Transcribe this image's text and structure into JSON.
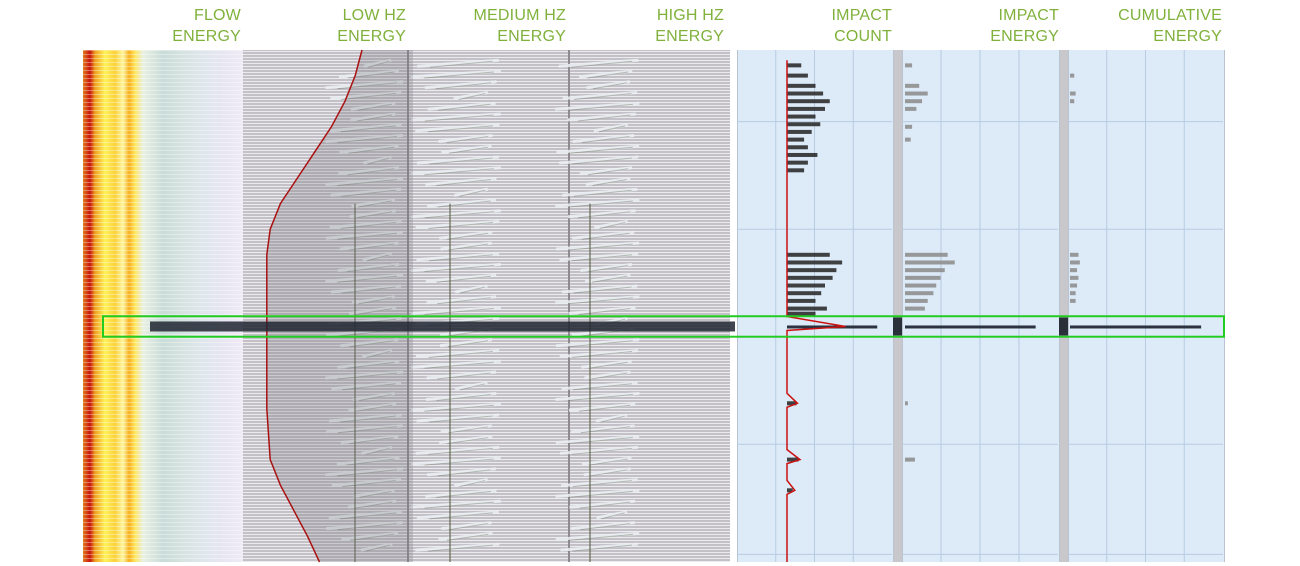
{
  "headers": {
    "flow": [
      "FLOW",
      "ENERGY"
    ],
    "low_hz": [
      "LOW HZ",
      "ENERGY"
    ],
    "medium_hz": [
      "MEDIUM HZ",
      "ENERGY"
    ],
    "high_hz": [
      "HIGH HZ",
      "ENERGY"
    ],
    "impact_count": [
      "IMPACT",
      "COUNT"
    ],
    "impact_energy": [
      "IMPACT",
      "ENERGY"
    ],
    "cumulative_energy": [
      "CUMULATIVE",
      "ENERGY"
    ]
  },
  "colors": {
    "header_text": "#7fb13b",
    "highlight_box": "#22cc22",
    "count_curve": "#cc1111",
    "flow_curve": "#aa1111",
    "bar_panel_bg": "#ddeaf8",
    "dark_band": "#1e2430"
  },
  "chart_data": {
    "type": "bar",
    "orientation": "horizontal",
    "x_axis": "track depth, top to bottom (unlabeled, 0–1)",
    "highlight": {
      "from": 0.52,
      "to": 0.56
    },
    "dark_band_position": 0.54,
    "impact_count": {
      "bars": [
        [
          0.03,
          0.15
        ],
        [
          0.05,
          0.22
        ],
        [
          0.07,
          0.3
        ],
        [
          0.085,
          0.38
        ],
        [
          0.1,
          0.45
        ],
        [
          0.115,
          0.4
        ],
        [
          0.13,
          0.3
        ],
        [
          0.145,
          0.35
        ],
        [
          0.16,
          0.26
        ],
        [
          0.175,
          0.18
        ],
        [
          0.19,
          0.22
        ],
        [
          0.205,
          0.32
        ],
        [
          0.22,
          0.22
        ],
        [
          0.235,
          0.18
        ],
        [
          0.4,
          0.45
        ],
        [
          0.415,
          0.58
        ],
        [
          0.43,
          0.52
        ],
        [
          0.445,
          0.48
        ],
        [
          0.46,
          0.4
        ],
        [
          0.475,
          0.36
        ],
        [
          0.49,
          0.3
        ],
        [
          0.505,
          0.42
        ],
        [
          0.515,
          0.3
        ],
        [
          0.54,
          0.95
        ],
        [
          0.69,
          0.1
        ],
        [
          0.8,
          0.12
        ],
        [
          0.86,
          0.06
        ]
      ],
      "curve_peaks": [
        [
          0.54,
          0.45
        ],
        [
          0.69,
          0.08
        ],
        [
          0.8,
          0.1
        ],
        [
          0.86,
          0.06
        ]
      ]
    },
    "impact_energy": {
      "bars": [
        [
          0.03,
          0.05
        ],
        [
          0.07,
          0.1
        ],
        [
          0.085,
          0.16
        ],
        [
          0.1,
          0.12
        ],
        [
          0.115,
          0.08
        ],
        [
          0.15,
          0.05
        ],
        [
          0.175,
          0.04
        ],
        [
          0.4,
          0.3
        ],
        [
          0.415,
          0.35
        ],
        [
          0.43,
          0.28
        ],
        [
          0.445,
          0.25
        ],
        [
          0.46,
          0.22
        ],
        [
          0.475,
          0.2
        ],
        [
          0.49,
          0.16
        ],
        [
          0.505,
          0.14
        ],
        [
          0.54,
          0.92
        ],
        [
          0.69,
          0.02
        ],
        [
          0.8,
          0.07
        ]
      ]
    },
    "cumulative_energy": {
      "bars": [
        [
          0.05,
          0.03
        ],
        [
          0.085,
          0.04
        ],
        [
          0.1,
          0.03
        ],
        [
          0.4,
          0.06
        ],
        [
          0.415,
          0.07
        ],
        [
          0.43,
          0.05
        ],
        [
          0.445,
          0.06
        ],
        [
          0.46,
          0.05
        ],
        [
          0.475,
          0.04
        ],
        [
          0.49,
          0.04
        ],
        [
          0.54,
          0.93
        ]
      ]
    },
    "flow_curve": [
      [
        0.0,
        0.7
      ],
      [
        0.05,
        0.66
      ],
      [
        0.1,
        0.6
      ],
      [
        0.15,
        0.52
      ],
      [
        0.2,
        0.42
      ],
      [
        0.25,
        0.32
      ],
      [
        0.3,
        0.22
      ],
      [
        0.35,
        0.16
      ],
      [
        0.4,
        0.14
      ],
      [
        0.5,
        0.14
      ],
      [
        0.6,
        0.14
      ],
      [
        0.7,
        0.14
      ],
      [
        0.8,
        0.16
      ],
      [
        0.85,
        0.22
      ],
      [
        0.9,
        0.3
      ],
      [
        0.95,
        0.38
      ],
      [
        1.0,
        0.45
      ]
    ]
  }
}
